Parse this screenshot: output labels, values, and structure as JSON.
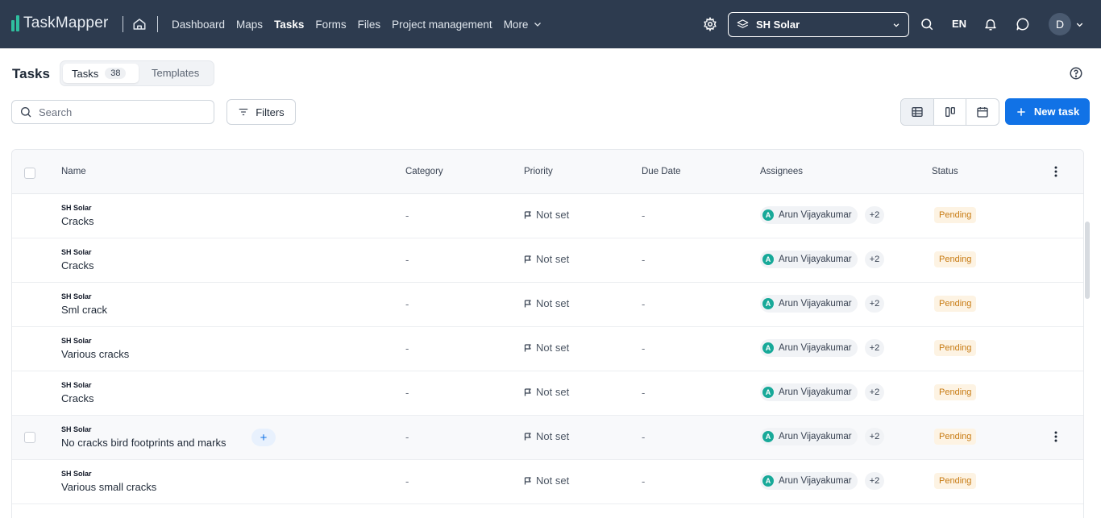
{
  "app": {
    "name": "TaskMapper",
    "brand_color": "#2fbf9f",
    "topbar_color": "#2d3b4f"
  },
  "nav": {
    "items": [
      {
        "label": "Dashboard",
        "active": false
      },
      {
        "label": "Maps",
        "active": false
      },
      {
        "label": "Tasks",
        "active": true
      },
      {
        "label": "Forms",
        "active": false
      },
      {
        "label": "Files",
        "active": false
      },
      {
        "label": "Project management",
        "active": false
      }
    ],
    "more_label": "More"
  },
  "project_selector": {
    "value": "SH Solar"
  },
  "language": "EN",
  "user": {
    "initial": "D"
  },
  "page": {
    "title": "Tasks",
    "tabs": [
      {
        "label": "Tasks",
        "count": "38",
        "active": true
      },
      {
        "label": "Templates",
        "active": false
      }
    ]
  },
  "toolbar": {
    "search_placeholder": "Search",
    "filters_label": "Filters",
    "new_task_label": "New task",
    "views": [
      "table-icon",
      "board-icon",
      "calendar-icon"
    ],
    "active_view": "table-icon"
  },
  "table": {
    "columns": [
      "Name",
      "Category",
      "Priority",
      "Due Date",
      "Assignees",
      "Status"
    ],
    "rows": [
      {
        "project": "SH Solar",
        "name": "Cracks",
        "category": "-",
        "priority": "Not set",
        "due": "-",
        "assignee": "Arun Vijayakumar",
        "assignee_initial": "A",
        "more": "+2",
        "status": "Pending"
      },
      {
        "project": "SH Solar",
        "name": "Cracks",
        "category": "-",
        "priority": "Not set",
        "due": "-",
        "assignee": "Arun Vijayakumar",
        "assignee_initial": "A",
        "more": "+2",
        "status": "Pending"
      },
      {
        "project": "SH Solar",
        "name": "Sml crack",
        "category": "-",
        "priority": "Not set",
        "due": "-",
        "assignee": "Arun Vijayakumar",
        "assignee_initial": "A",
        "more": "+2",
        "status": "Pending"
      },
      {
        "project": "SH Solar",
        "name": "Various cracks",
        "category": "-",
        "priority": "Not set",
        "due": "-",
        "assignee": "Arun Vijayakumar",
        "assignee_initial": "A",
        "more": "+2",
        "status": "Pending"
      },
      {
        "project": "SH Solar",
        "name": "Cracks",
        "category": "-",
        "priority": "Not set",
        "due": "-",
        "assignee": "Arun Vijayakumar",
        "assignee_initial": "A",
        "more": "+2",
        "status": "Pending"
      },
      {
        "project": "SH Solar",
        "name": "No cracks bird footprints and marks",
        "category": "-",
        "priority": "Not set",
        "due": "-",
        "assignee": "Arun Vijayakumar",
        "assignee_initial": "A",
        "more": "+2",
        "status": "Pending",
        "hovered": true,
        "add_label": "+"
      },
      {
        "project": "SH Solar",
        "name": "Various small cracks",
        "category": "-",
        "priority": "Not set",
        "due": "-",
        "assignee": "Arun Vijayakumar",
        "assignee_initial": "A",
        "more": "+2",
        "status": "Pending"
      }
    ]
  },
  "colors": {
    "accent": "#1172e6",
    "status_pending_bg": "#fdf3e3",
    "status_pending_text": "#c77a11"
  }
}
